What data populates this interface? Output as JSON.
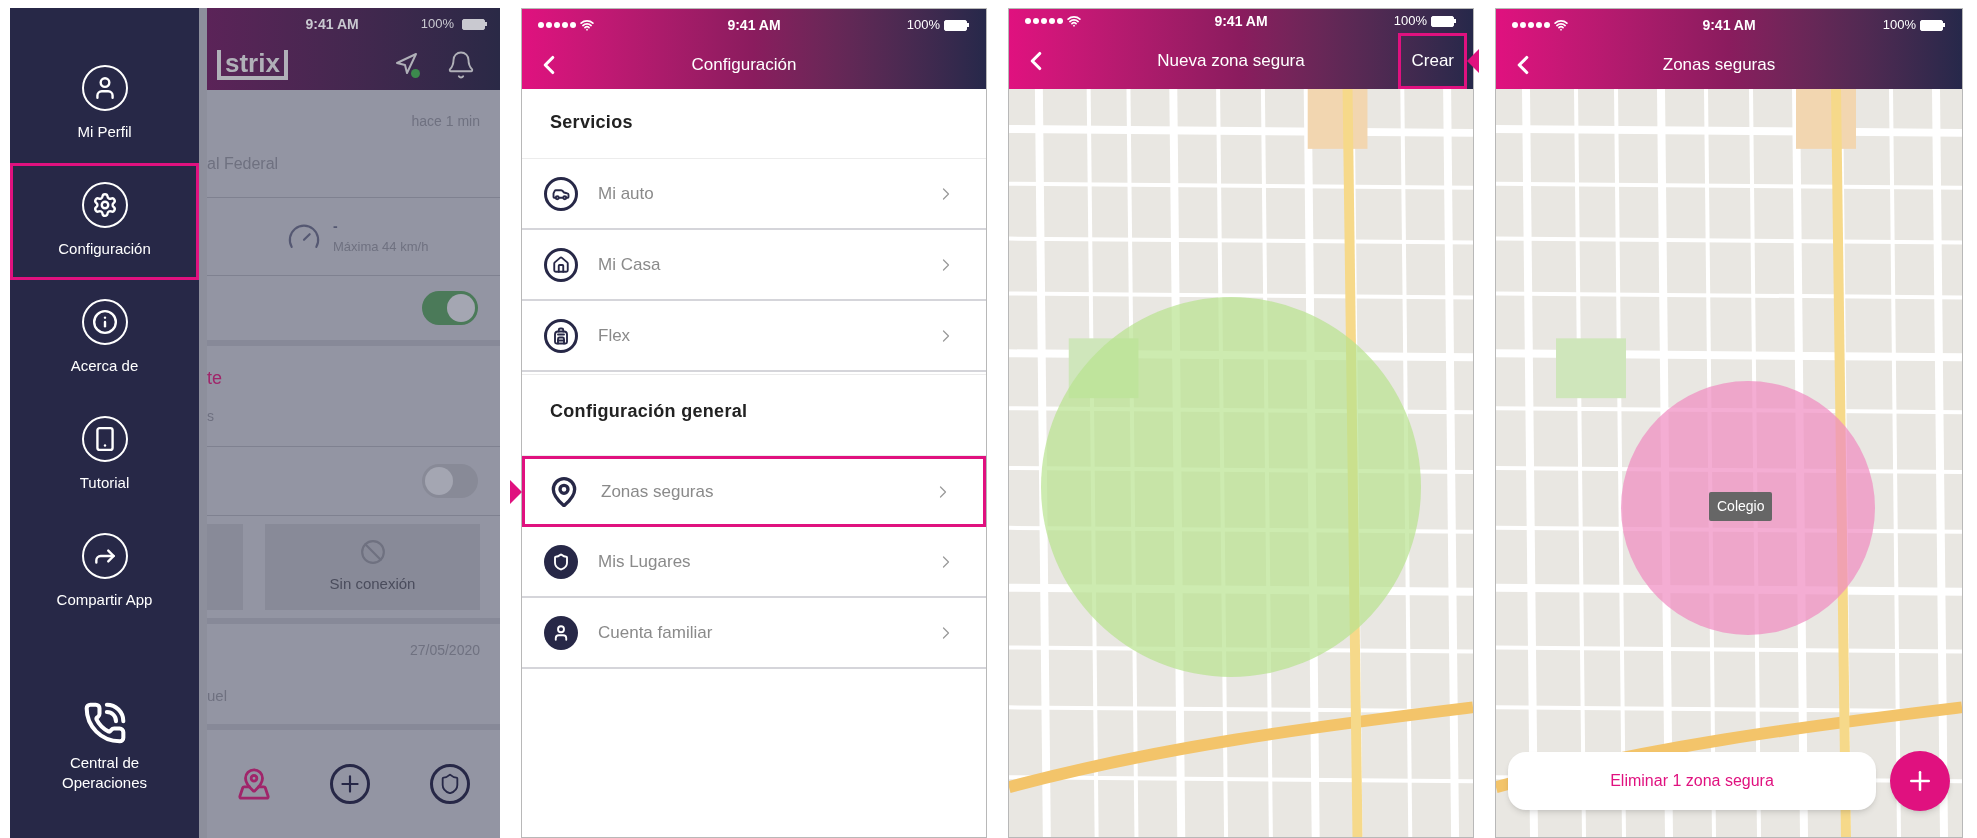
{
  "menu_screen": {
    "status_bar": {
      "time": "9:41 AM",
      "battery": "100%"
    },
    "logo": "strix",
    "drawer": {
      "items": [
        {
          "label": "Mi Perfil",
          "highlighted": false
        },
        {
          "label": "Configuración",
          "highlighted": true
        },
        {
          "label": "Acerca de",
          "highlighted": false
        },
        {
          "label": "Tutorial",
          "highlighted": false
        },
        {
          "label": "Compartir App",
          "highlighted": false
        }
      ],
      "footer_item": {
        "label": "Central de Operaciones",
        "highlighted": false
      }
    },
    "background": {
      "time_ago": "hace 1 min",
      "location": "al Federal",
      "speed_value": "-",
      "speed_max": "Máxima 44 km/h",
      "top_toggle": {
        "on": true
      },
      "alert_title": "te",
      "alert_subtitle": "s",
      "bottom_toggle": {
        "on": false
      },
      "card_status": "Sin conexión",
      "date": "27/05/2020",
      "name": "uel"
    }
  },
  "settings_screen": {
    "status_bar": {
      "time": "9:41 AM",
      "battery": "100%"
    },
    "title": "Configuración",
    "sections": [
      {
        "heading": "Servicios",
        "items": [
          {
            "label": "Mi auto",
            "highlighted": false
          },
          {
            "label": "Mi Casa",
            "highlighted": false
          },
          {
            "label": "Flex",
            "highlighted": false
          }
        ]
      },
      {
        "heading": "Configuración general",
        "items": [
          {
            "label": "Zonas seguras",
            "highlighted": true
          },
          {
            "label": "Mis Lugares",
            "highlighted": false
          },
          {
            "label": "Cuenta familiar",
            "highlighted": false
          }
        ]
      }
    ]
  },
  "new_zone_screen": {
    "status_bar": {
      "time": "9:41 AM",
      "battery": "100%"
    },
    "title": "Nueva zona segura",
    "action": {
      "label": "Crear",
      "highlighted": true
    }
  },
  "zones_screen": {
    "status_bar": {
      "time": "9:41 AM",
      "battery": "100%"
    },
    "title": "Zonas seguras",
    "zone_label": "Colegio",
    "delete_button": "Eliminar 1 zona segura"
  }
}
